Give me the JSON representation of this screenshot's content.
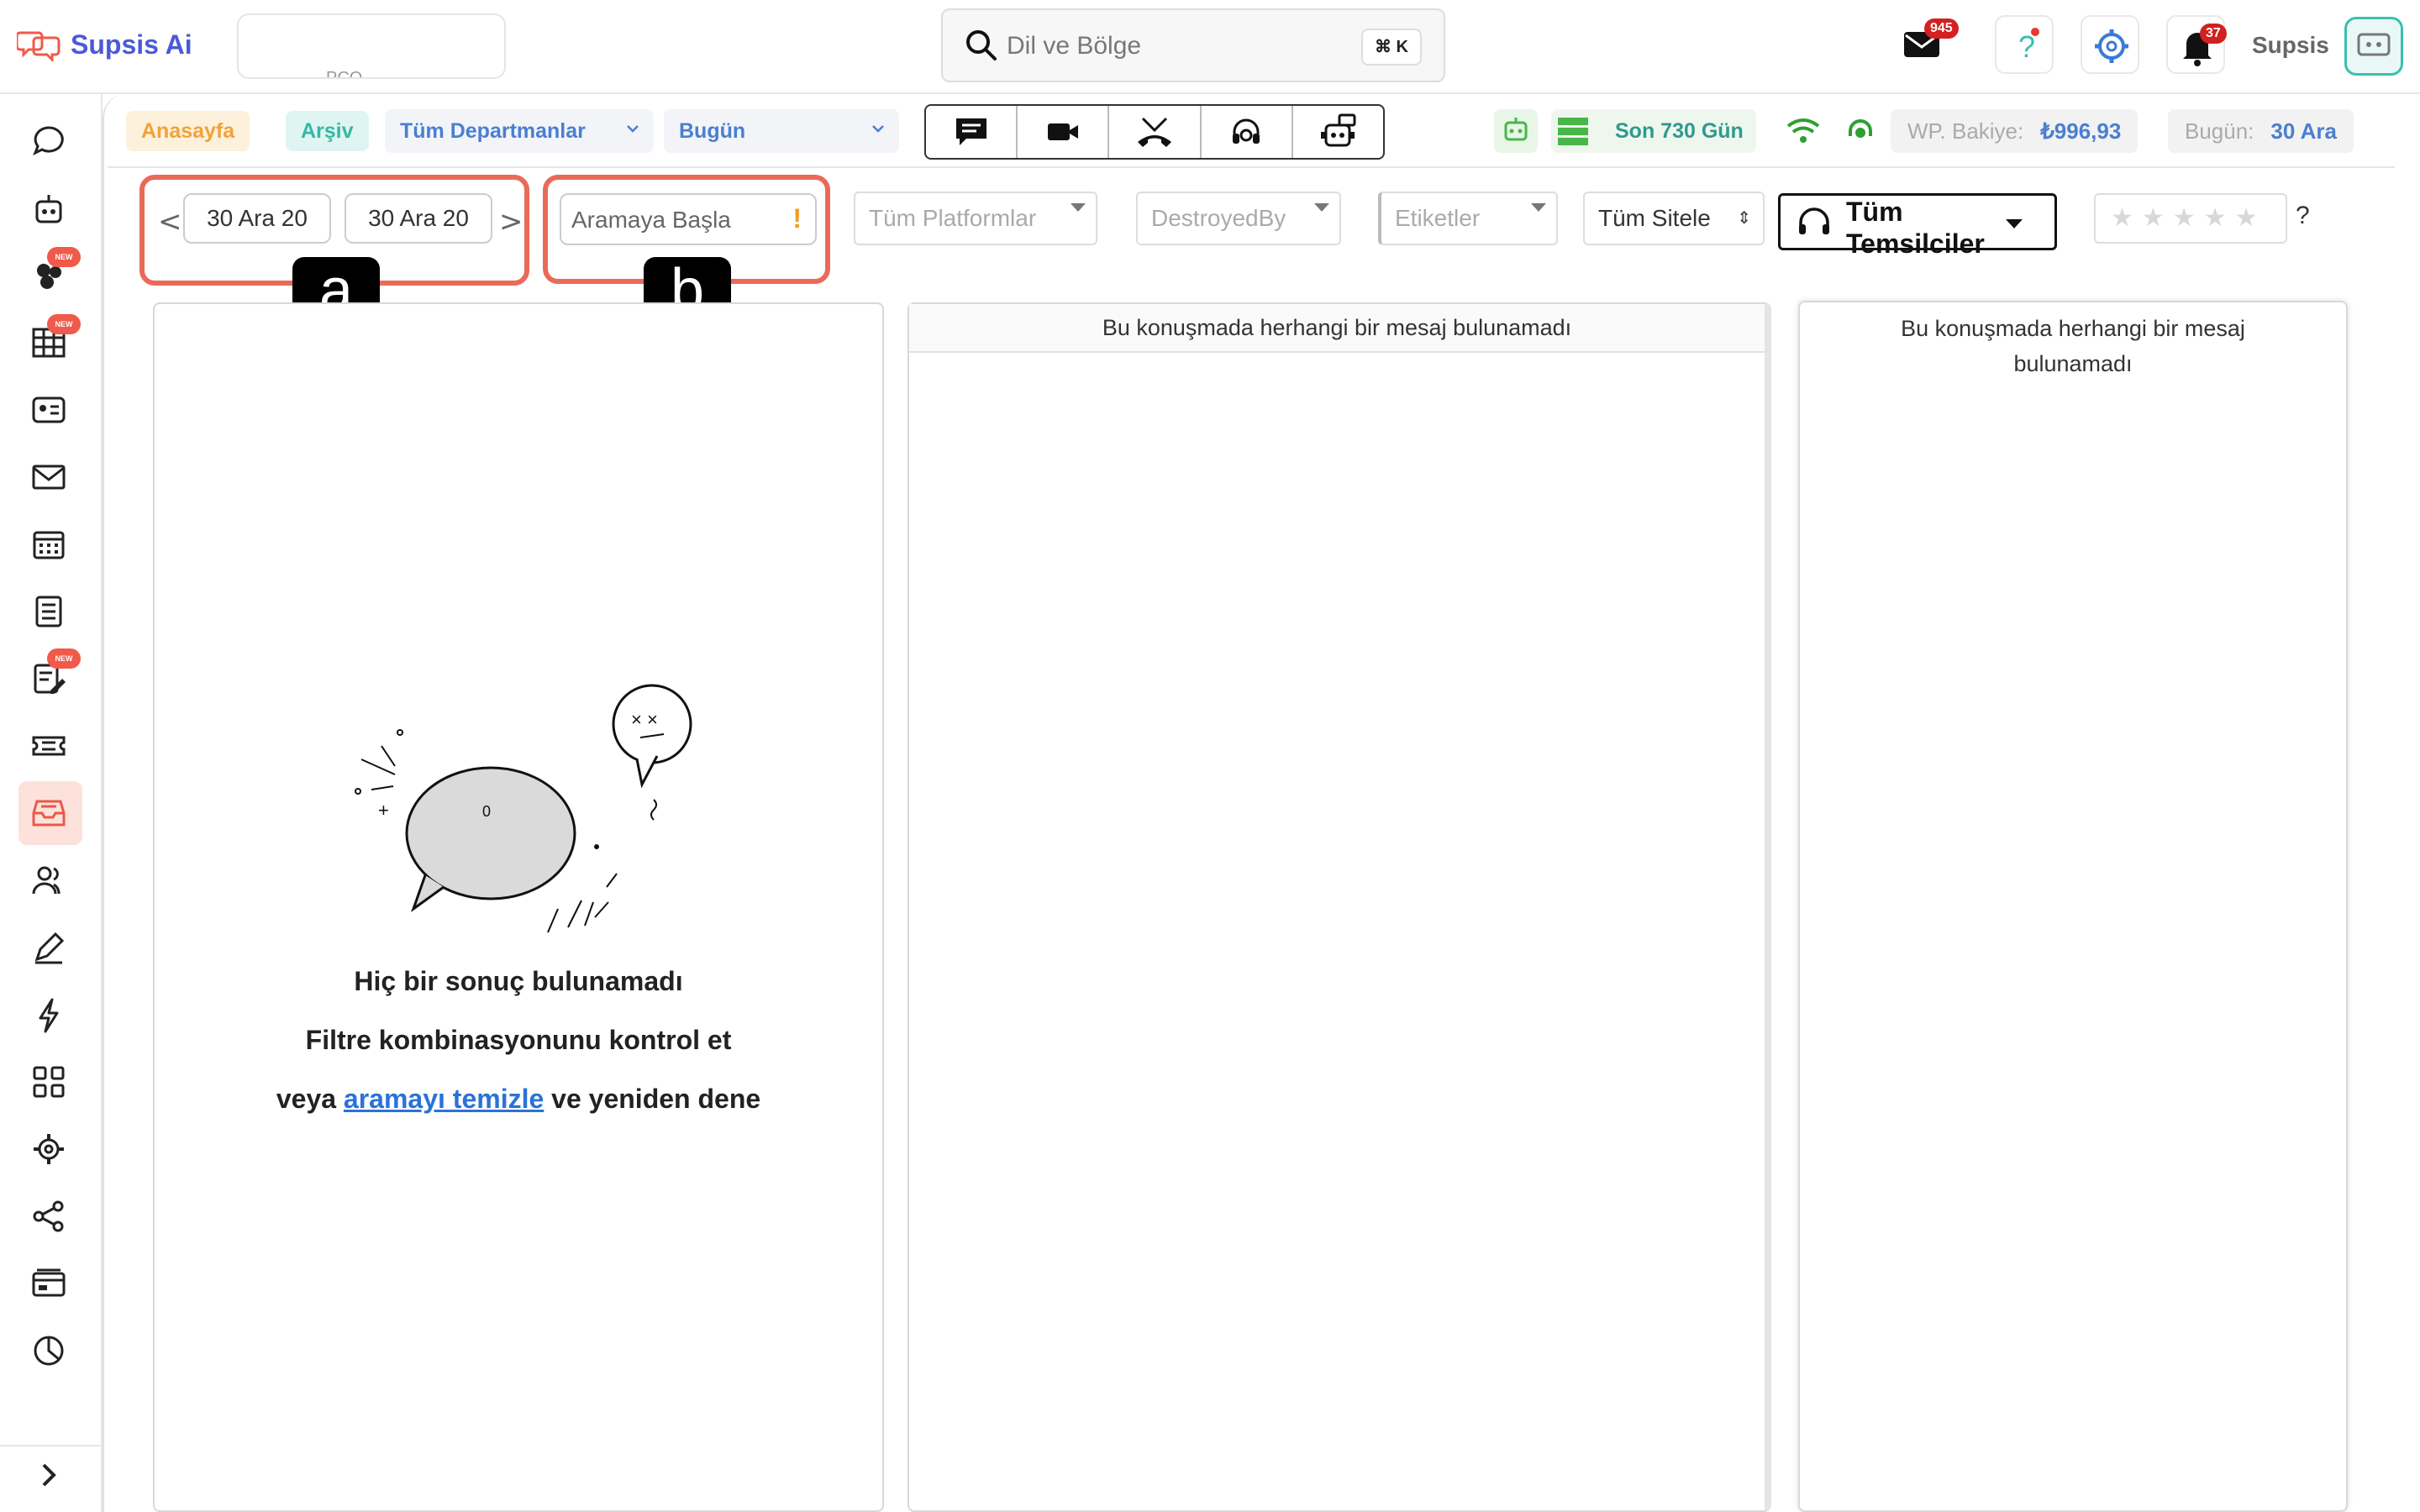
{
  "app": {
    "logo_text": "Supsis Ai",
    "workspace_label": "PCO"
  },
  "search": {
    "placeholder": "Dil ve Bölge",
    "shortcut": "⌘ K"
  },
  "topbar": {
    "mail_badge": "945",
    "notif_badge": "37",
    "user_name": "Supsis"
  },
  "sidebar": {
    "new_badge": "NEW",
    "expand_icon": "chevron-right-icon"
  },
  "toolbar": {
    "home_chip": "Anasayfa",
    "archive_chip": "Arşiv",
    "departments": "Tüm Departmanlar",
    "period": "Bugün",
    "range_label": "Son 730 Gün",
    "wp_label": "WP. Bakiye:",
    "wp_value": "₺996,93",
    "today_label": "Bugün:",
    "today_value": "30 Ara"
  },
  "filters": {
    "date_from": "30 Ara 20",
    "date_to": "30 Ara 20",
    "search_placeholder": "Aramaya Başla",
    "search_warning": "!",
    "platforms": "Tüm Platformlar",
    "destroyed_by": "DestroyedBy",
    "tags": "Etiketler",
    "sites": "Tüm Sitele",
    "agents": "Tüm Temsilciler",
    "rating_help": "?"
  },
  "annotations": {
    "a": "a",
    "b": "b"
  },
  "panels": {
    "empty_title": "Hiç bir sonuç bulunamadı",
    "empty_hint1": "Filtre kombinasyonunu kontrol et",
    "empty_hint2_prefix": "veya",
    "empty_hint2_link": "aramayı temizle",
    "empty_hint2_suffix": "ve yeniden dene",
    "illustration_count": "0",
    "no_message_center": "Bu konuşmada herhangi bir mesaj bulunamadı",
    "no_message_right": "Bu konuşmada herhangi bir mesaj bulunamadı"
  },
  "colors": {
    "accent": "#4a7fd0",
    "frame": "#ea6a5a",
    "brand": "#4a5ad8"
  }
}
